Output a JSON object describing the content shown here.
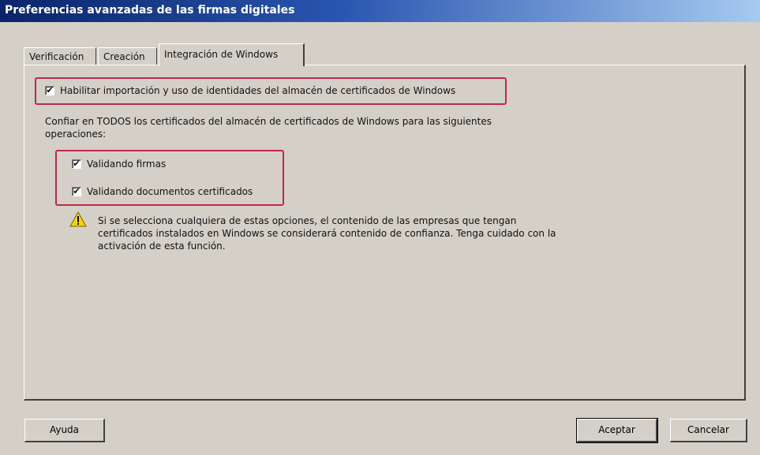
{
  "window": {
    "title": "Preferencias avanzadas de las firmas digitales"
  },
  "tabs": [
    {
      "label": "Verificación",
      "active": false
    },
    {
      "label": "Creación",
      "active": false
    },
    {
      "label": "Integración de Windows",
      "active": true
    }
  ],
  "panel": {
    "enable_import": {
      "label": "Habilitar importación y uso de identidades del almacén de certificados de Windows",
      "checked": true
    },
    "trust_text_line1": "Confiar en TODOS los certificados del almacén de certificados de Windows para las siguientes",
    "trust_text_line2": "operaciones:",
    "validating_signatures": {
      "label": "Validando firmas",
      "checked": true
    },
    "validating_certified_docs": {
      "label": "Validando documentos certificados",
      "checked": true
    },
    "warning": {
      "icon": "warning-icon",
      "line1": "Si se selecciona cualquiera de estas opciones, el contenido de las empresas que tengan",
      "line2": "certificados instalados en Windows se considerará contenido de confianza. Tenga cuidado con la",
      "line3": "activación de esta función."
    },
    "highlight_color": "#c3264e"
  },
  "buttons": {
    "help": "Ayuda",
    "accept": "Aceptar",
    "cancel": "Cancelar"
  },
  "check_mark": "✔"
}
